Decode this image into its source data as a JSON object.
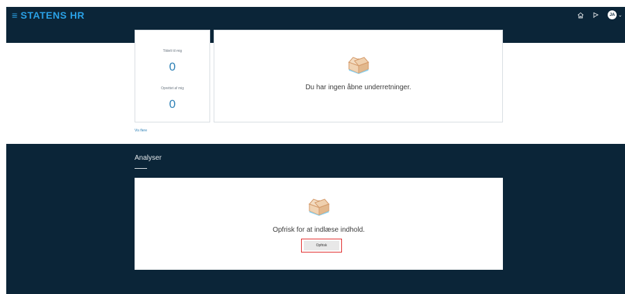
{
  "header": {
    "menu_glyph": "≡",
    "app_title": "STATENS HR",
    "avatar_initials": "JA"
  },
  "kpi_card": {
    "assigned_label": "Tildelt til mig",
    "assigned_value": "0",
    "created_label": "Oprettet af mig",
    "created_value": "0"
  },
  "notifications": {
    "empty_message": "Du har ingen åbne underretninger."
  },
  "vis_flere_label": "Vis flere",
  "analyser": {
    "title": "Analyser",
    "message": "Opfrisk for at indlæse indhold.",
    "refresh_button_label": "Opfrisk"
  },
  "colors": {
    "navy": "#0b2538",
    "brand_blue": "#2aa1e6",
    "value_blue": "#2b7fb5",
    "highlight_red": "#e02a2a"
  },
  "icons": {
    "menu": "hamburger-menu-icon",
    "home": "home-icon",
    "flag": "flag-icon",
    "empty_box": "open-box-icon"
  }
}
